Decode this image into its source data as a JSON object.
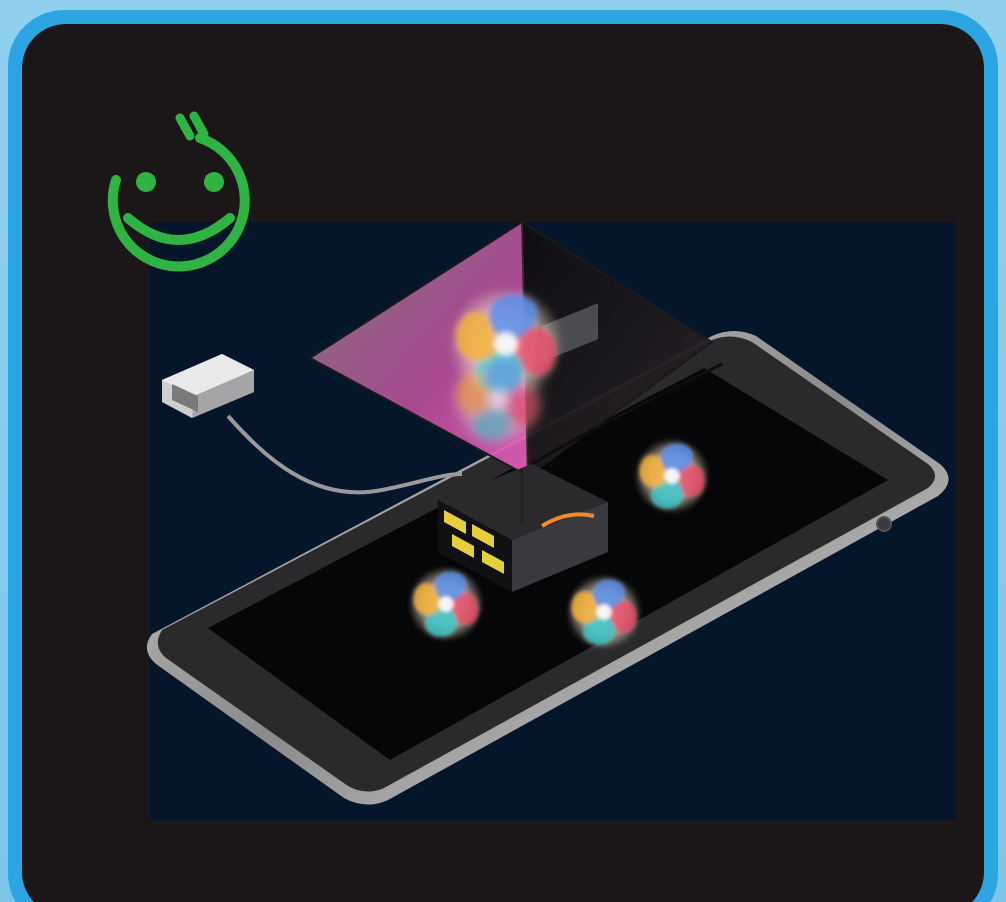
{
  "illustration": {
    "icons": [
      "smiley-face-icon",
      "usb-plug-icon",
      "tablet-icon",
      "hologram-pyramid-icon",
      "projector-box-icon",
      "swirl-orb-icon"
    ],
    "colors": {
      "frame_blue": "#2ba6e3",
      "background_light_blue": "#8fd0ee",
      "panel_dark": "#1b1617",
      "scene_navy": "#05152a",
      "smiley_green": "#2fb443",
      "pyramid_magenta": "#d44fb0",
      "hazard_yellow": "#e6cf3a"
    }
  }
}
